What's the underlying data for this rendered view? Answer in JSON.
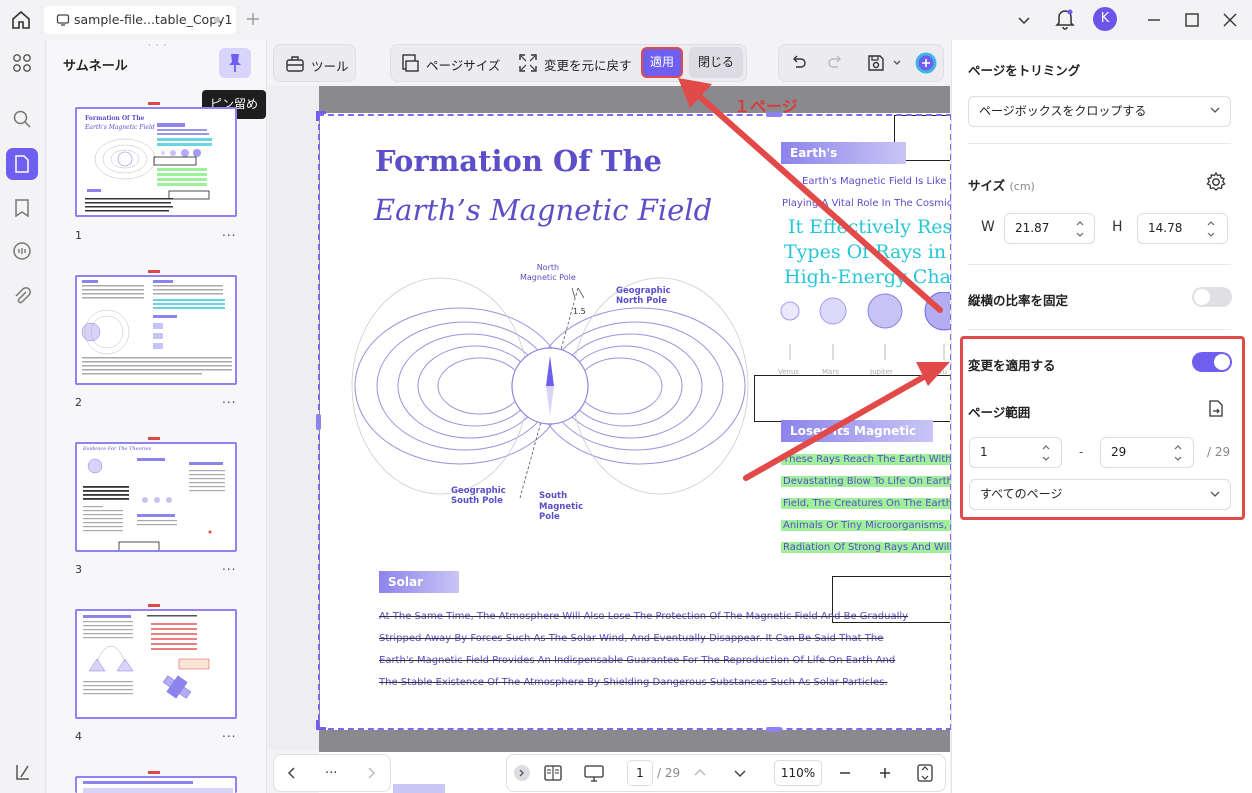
{
  "titlebar": {
    "tab_title": "sample-file...table_Copy1"
  },
  "avatar": {
    "letter": "K"
  },
  "thumbnails": {
    "title": "サムネール",
    "pin_tooltip": "ピン留め",
    "pages": [
      {
        "num": "1",
        "more": "..."
      },
      {
        "num": "2",
        "more": "..."
      },
      {
        "num": "3",
        "more": "..."
      },
      {
        "num": "4",
        "more": "..."
      }
    ]
  },
  "toolbar": {
    "tools": "ツール",
    "page_size": "ページサイズ",
    "revert": "変更を元に戻す",
    "apply": "適用",
    "close": "閉じる"
  },
  "annotation": {
    "label": "１ページ"
  },
  "document": {
    "title1": "Formation Of The",
    "title2": "Earth’s Magnetic Field",
    "north_magnetic_pole_1": "North",
    "north_magnetic_pole_2": "Magnetic Pole",
    "geo_north_1": "Geographic",
    "geo_north_2": "North Pole",
    "geo_south_1": "Geographic",
    "geo_south_2": "South Pole",
    "south_mag_1": "South",
    "south_mag_2": "Magnetic",
    "south_mag_3": "Pole",
    "angle": "1.5",
    "earths_magnetic": "Earth's Magnetic",
    "em_line1": "Earth's Magnetic Field Is Like A",
    "em_line2": "Playing A Vital Role In The Cosmic E",
    "cyan1": "It Effectively Resis",
    "cyan2": "Types Of Rays in T",
    "cyan3": "High-Energy Char",
    "planets": [
      "Venus",
      "Mars",
      "Jupiter",
      "Satu"
    ],
    "loses_section": "Loses Its Magnetic Field",
    "hl_lines": [
      "These Rays Reach The Earth Witho",
      "Devastating Blow To Life On Earth. C",
      "Field, The Creatures On The Earth's",
      "Animals Or Tiny Microorganisms, Wil",
      "Radiation Of Strong Rays And Will Q"
    ],
    "solar_wind": "Solar Wind",
    "solar_lines": [
      "At The Same Time, The Atmosphere Will Also Lose The Protection Of The Magnetic Field And Be Gradually",
      "Stripped Away By Forces Such As The Solar Wind, And Eventually Disappear. It Can Be Said That The",
      "Earth's Magnetic Field Provides An Indispensable Guarantee For The Reproduction Of Life On Earth And",
      "The Stable Existence Of The Atmosphere By Shielding Dangerous Substances Such As Solar Particles."
    ]
  },
  "right_panel": {
    "title": "ページをトリミング",
    "crop_mode": "ページボックスをクロップする",
    "size_label": "サイズ",
    "size_unit": "(cm)",
    "w_label": "W",
    "w_value": "21.87",
    "h_label": "H",
    "h_value": "14.78",
    "lock_ratio": "縦横の比率を固定",
    "lock_ratio_on": false,
    "apply_changes": "変更を適用する",
    "apply_changes_on": true,
    "page_range": "ページ範囲",
    "range_from": "1",
    "range_dash": "-",
    "range_to": "29",
    "range_total": "/ 29",
    "pages_select": "すべてのページ"
  },
  "bottombar": {
    "page_more": "...",
    "current_page": "1",
    "total_pages": "/ 29",
    "zoom": "110%"
  },
  "colors": {
    "accent": "#6e5ff0",
    "annotation_red": "#e24a4a",
    "highlight_green": "#9ff09a",
    "doc_purple": "#5b4ec8"
  }
}
